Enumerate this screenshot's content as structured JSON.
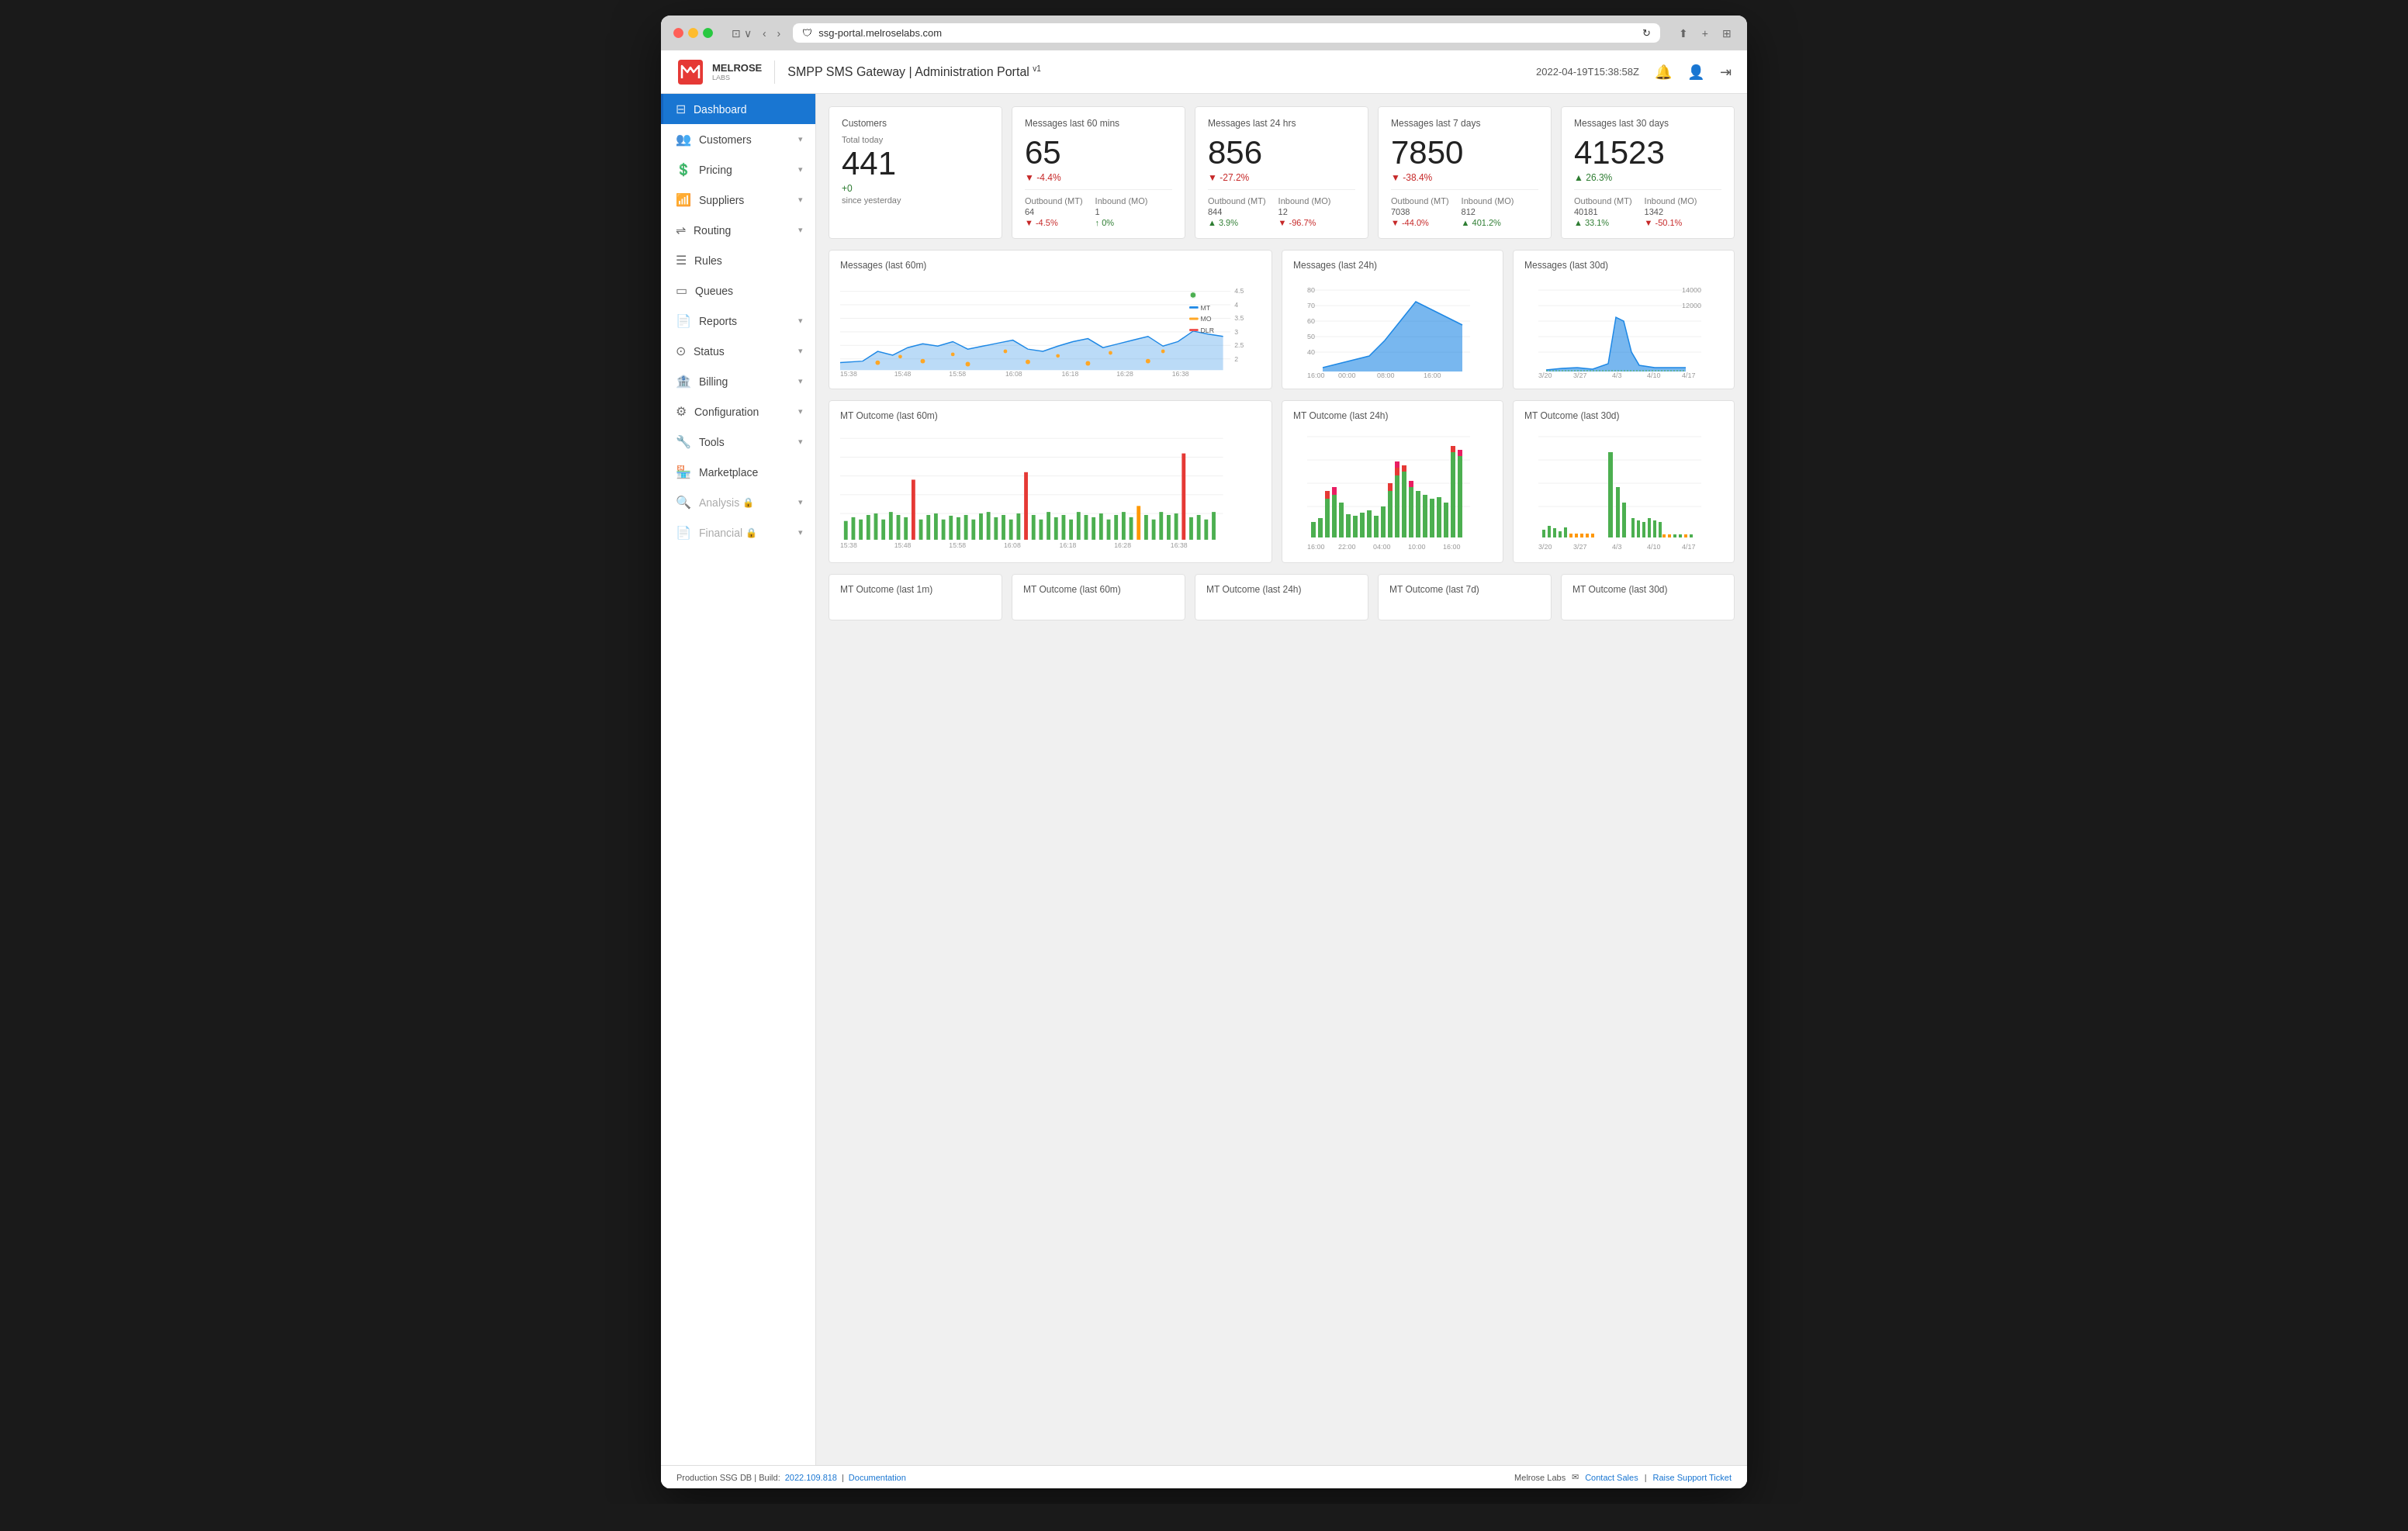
{
  "browser": {
    "url": "ssg-portal.melroselabs.com",
    "shield_icon": "🛡",
    "reload_icon": "↻"
  },
  "header": {
    "logo_brand": "MELROSE",
    "logo_sub": "LABS",
    "app_title": "SMPP SMS Gateway | Administration Portal",
    "version": "v1",
    "timestamp": "2022-04-19T15:38:58Z",
    "bell_icon": "🔔",
    "user_icon": "👤",
    "logout_icon": "→"
  },
  "sidebar": {
    "items": [
      {
        "id": "dashboard",
        "label": "Dashboard",
        "icon": "⊡",
        "active": true,
        "has_chevron": false
      },
      {
        "id": "customers",
        "label": "Customers",
        "icon": "👥",
        "active": false,
        "has_chevron": true
      },
      {
        "id": "pricing",
        "label": "Pricing",
        "icon": "💰",
        "active": false,
        "has_chevron": true
      },
      {
        "id": "suppliers",
        "label": "Suppliers",
        "icon": "📊",
        "active": false,
        "has_chevron": true
      },
      {
        "id": "routing",
        "label": "Routing",
        "icon": "⇌",
        "active": false,
        "has_chevron": true
      },
      {
        "id": "rules",
        "label": "Rules",
        "icon": "☰",
        "active": false,
        "has_chevron": false
      },
      {
        "id": "queues",
        "label": "Queues",
        "icon": "▭",
        "active": false,
        "has_chevron": false
      },
      {
        "id": "reports",
        "label": "Reports",
        "icon": "📄",
        "active": false,
        "has_chevron": true
      },
      {
        "id": "status",
        "label": "Status",
        "icon": "⚙",
        "active": false,
        "has_chevron": true
      },
      {
        "id": "billing",
        "label": "Billing",
        "icon": "🏦",
        "active": false,
        "has_chevron": true
      },
      {
        "id": "configuration",
        "label": "Configuration",
        "icon": "⚙",
        "active": false,
        "has_chevron": true
      },
      {
        "id": "tools",
        "label": "Tools",
        "icon": "🔧",
        "active": false,
        "has_chevron": true
      },
      {
        "id": "marketplace",
        "label": "Marketplace",
        "icon": "🏪",
        "active": false,
        "has_chevron": false
      },
      {
        "id": "analysis",
        "label": "Analysis",
        "icon": "🔍",
        "active": false,
        "has_chevron": true,
        "locked": true
      },
      {
        "id": "financial",
        "label": "Financial",
        "icon": "📄",
        "active": false,
        "has_chevron": true,
        "locked": true
      }
    ]
  },
  "stats": {
    "customers": {
      "title": "Customers",
      "total_label": "Total today",
      "value": "441",
      "change_label": "+0",
      "change_sub": "since yesterday"
    },
    "msgs_60m": {
      "title": "Messages last 60 mins",
      "value": "65",
      "change": "▼ -4.4%",
      "change_type": "negative",
      "outbound_label": "Outbound (MT)",
      "outbound_value": "64",
      "outbound_change": "▼ -4.5%",
      "inbound_label": "Inbound (MO)",
      "inbound_value": "1",
      "inbound_change": "↑ 0%"
    },
    "msgs_24h": {
      "title": "Messages last 24 hrs",
      "value": "856",
      "change": "▼ -27.2%",
      "change_type": "negative",
      "outbound_label": "Outbound (MT)",
      "outbound_value": "844",
      "outbound_change": "▲ 3.9%",
      "inbound_label": "Inbound (MO)",
      "inbound_value": "12",
      "inbound_change": "▼ -96.7%"
    },
    "msgs_7d": {
      "title": "Messages last 7 days",
      "value": "7850",
      "change": "▼ -38.4%",
      "change_type": "negative",
      "outbound_label": "Outbound (MT)",
      "outbound_value": "7038",
      "outbound_change": "▼ -44.0%",
      "inbound_label": "Inbound (MO)",
      "inbound_value": "812",
      "inbound_change": "▲ 401.2%"
    },
    "msgs_30d": {
      "title": "Messages last 30 days",
      "value": "41523",
      "change": "▲ 26.3%",
      "change_type": "positive",
      "outbound_label": "Outbound (MT)",
      "outbound_value": "40181",
      "outbound_change": "▲ 33.1%",
      "inbound_label": "Inbound (MO)",
      "inbound_value": "1342",
      "inbound_change": "▼ -50.1%"
    }
  },
  "charts": {
    "msgs_60m": {
      "title": "Messages (last 60m)",
      "x_labels": [
        "15:38",
        "15:48",
        "15:58",
        "16:08",
        "16:18",
        "16:28",
        "16:38"
      ],
      "legend": [
        {
          "label": "MT",
          "color": "#1e88e5"
        },
        {
          "label": "MO",
          "color": "#ffa726"
        },
        {
          "label": "DLR",
          "color": "#ef5350"
        }
      ]
    },
    "msgs_24h": {
      "title": "Messages (last 24h)",
      "x_labels": [
        "16:00",
        "00:00",
        "08:00",
        "16:00"
      ]
    },
    "msgs_30d": {
      "title": "Messages (last 30d)",
      "x_labels": [
        "3/20",
        "3/27",
        "4/3",
        "4/10",
        "4/17"
      ]
    },
    "mt_outcome_60m": {
      "title": "MT Outcome (last 60m)",
      "x_labels": [
        "15:38",
        "15:48",
        "15:58",
        "16:08",
        "16:18",
        "16:28",
        "16:38"
      ]
    },
    "mt_outcome_24h": {
      "title": "MT Outcome (last 24h)",
      "x_labels": [
        "16:00",
        "22:00",
        "04:00",
        "10:00",
        "16:00"
      ]
    },
    "mt_outcome_30d": {
      "title": "MT Outcome (last 30d)",
      "x_labels": [
        "3/20",
        "3/27",
        "4/3",
        "4/10",
        "4/17"
      ]
    }
  },
  "bottom_cards": [
    {
      "title": "MT Outcome (last 1m)"
    },
    {
      "title": "MT Outcome (last 60m)"
    },
    {
      "title": "MT Outcome (last 24h)"
    },
    {
      "title": "MT Outcome (last 7d)"
    },
    {
      "title": "MT Outcome (last 30d)"
    }
  ],
  "footer": {
    "left": "Production SSG DB  |  Build:",
    "build_link": "2022.109.818",
    "separator": " | ",
    "docs_link": "Documentation",
    "right_prefix": "Melrose Labs",
    "contact_link": "Contact Sales",
    "support_link": "Raise Support Ticket"
  }
}
